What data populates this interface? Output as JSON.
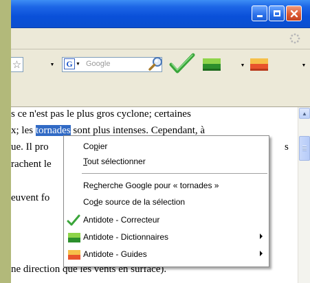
{
  "toolbar": {
    "search_placeholder": "Google",
    "search_engine_letter": "G"
  },
  "content": {
    "lines": [
      "s ce n'est pas le plus gros cyclone; certaines",
      "x; les ",
      "tornades",
      " sont plus intenses. Cependant, à",
      "ue. Il pro",
      "s",
      "rachent le",
      "euvent fo",
      "ne direction que les vents en surface)."
    ]
  },
  "context_menu": {
    "copy": {
      "pre": "Co",
      "key": "p",
      "post": "ier"
    },
    "select_all": {
      "pre": "",
      "key": "T",
      "post": "out sélectionner"
    },
    "google_search": {
      "pre": "Re",
      "key": "c",
      "post": "herche Google pour « tornades »"
    },
    "view_source": {
      "pre": "Co",
      "key": "d",
      "post": "e source de la sélection"
    },
    "antidote_correcteur": "Antidote - Correcteur",
    "antidote_dictionnaires": "Antidote - Dictionnaires",
    "antidote_guides": "Antidote - Guides"
  },
  "colors": {
    "titlebar": "#0a50d9",
    "selection": "#316ac5",
    "close_button": "#dd5a32"
  }
}
